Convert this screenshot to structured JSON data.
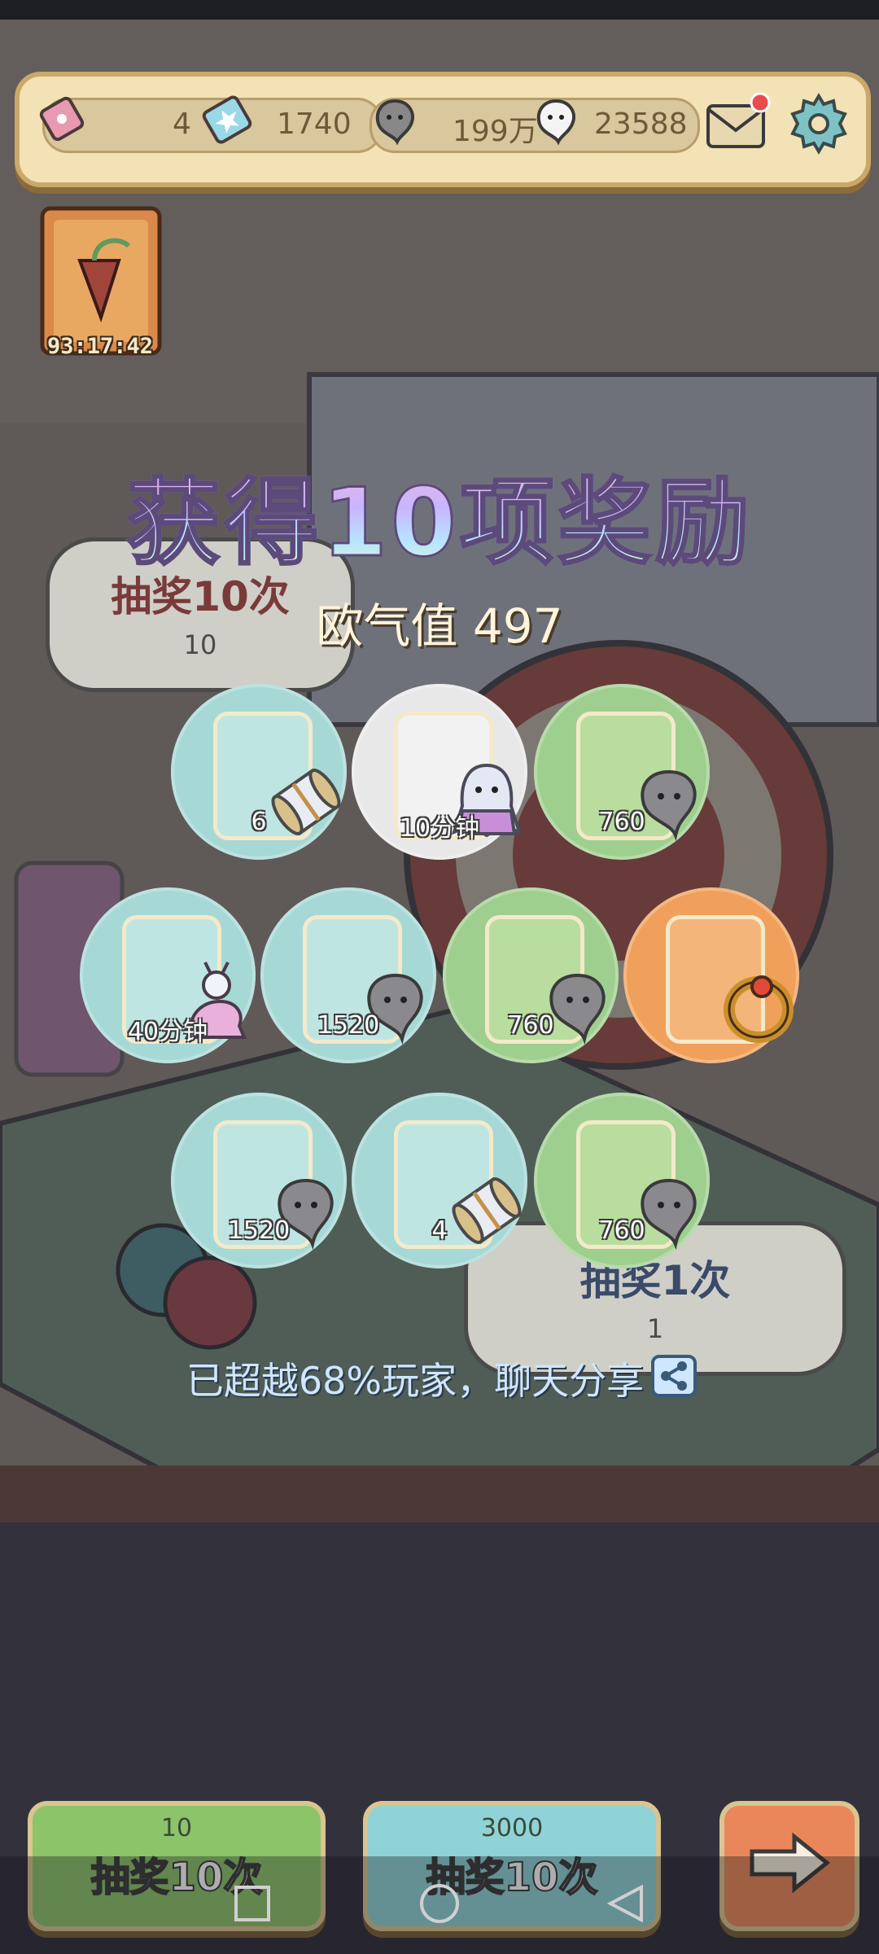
{
  "topbar": {
    "ticket_count": "4",
    "star_ticket_count": "1740",
    "grey_soul_count": "199万",
    "white_soul_count": "23588"
  },
  "event": {
    "timer": "93:17:42"
  },
  "background_buttons": {
    "draw10_label": "抽奖10次",
    "draw10_cost": "10",
    "draw1_label": "抽奖1次",
    "draw1_cost": "1"
  },
  "result": {
    "title": "获得10项奖励",
    "luck": "欧气值 497",
    "rewards": [
      {
        "item": "scroll-icon",
        "qty": "6",
        "bg": "#a6d8d6"
      },
      {
        "item": "ghost-icon",
        "qty": "10分钟",
        "bg": "#e8e8e8"
      },
      {
        "item": "soul-icon",
        "qty": "760",
        "bg": "#9fcf8f"
      },
      {
        "item": "snail-icon",
        "qty": "40分钟",
        "bg": "#a6d8d6"
      },
      {
        "item": "soul-icon",
        "qty": "1520",
        "bg": "#a6d8d6"
      },
      {
        "item": "soul-icon",
        "qty": "760",
        "bg": "#9fcf8f"
      },
      {
        "item": "ring-icon",
        "qty": "",
        "bg": "#f0a05a"
      },
      {
        "item": "soul-icon",
        "qty": "1520",
        "bg": "#a6d8d6"
      },
      {
        "item": "scroll-icon",
        "qty": "4",
        "bg": "#a6d8d6"
      },
      {
        "item": "soul-icon",
        "qty": "760",
        "bg": "#9fcf8f"
      }
    ],
    "share_text": "已超越68%玩家，聊天分享"
  },
  "bottom_buttons": {
    "draw_ticket_cost": "10",
    "draw_ticket_label": "抽奖10次",
    "draw_soul_cost": "3000",
    "draw_soul_label": "抽奖10次"
  },
  "colors": {
    "accent_green": "#8cc46a",
    "accent_teal": "#8fd3d6",
    "accent_orange": "#e9875a"
  }
}
